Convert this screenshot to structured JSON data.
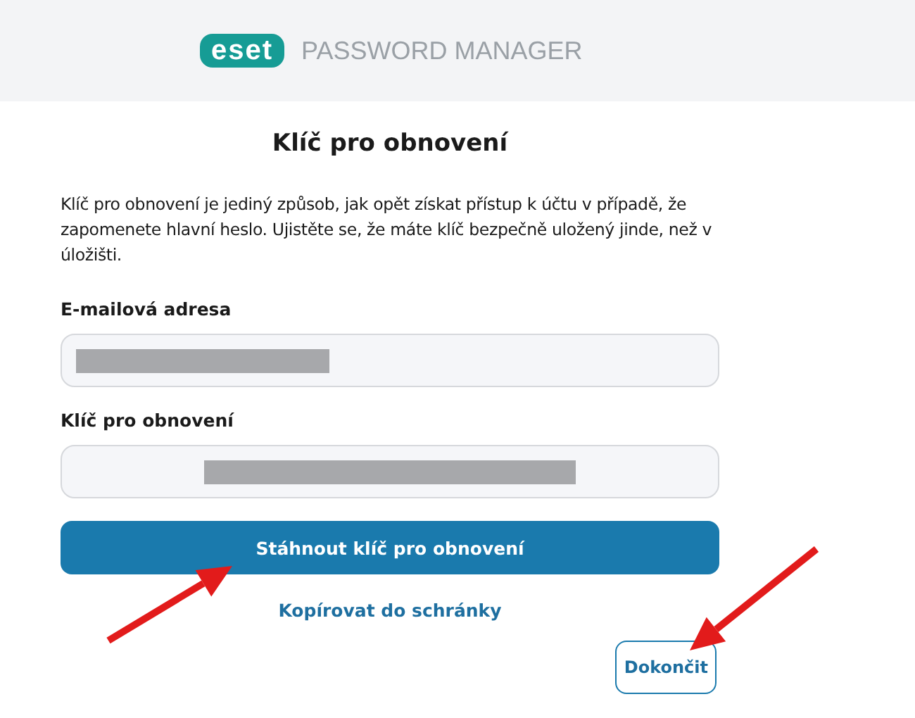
{
  "header": {
    "logo": "eset",
    "product": "PASSWORD MANAGER"
  },
  "title": "Klíč pro obnovení",
  "description": "Klíč pro obnovení je jediný způsob, jak opět získat přístup k účtu v případě, že zapomenete hlavní heslo. Ujistěte se, že máte klíč bezpečně uložený jinde, než v úložišti.",
  "fields": [
    {
      "label": "E-mailová adresa",
      "value_centered": false
    },
    {
      "label": "Klíč pro obnovení",
      "value_centered": true
    }
  ],
  "primary_button": "Stáhnout klíč pro obnovení",
  "link": "Kopírovat do schránky",
  "finish_button": "Dokončit",
  "annotations": [
    {
      "kind": "arrow"
    },
    {
      "kind": "arrow"
    }
  ]
}
